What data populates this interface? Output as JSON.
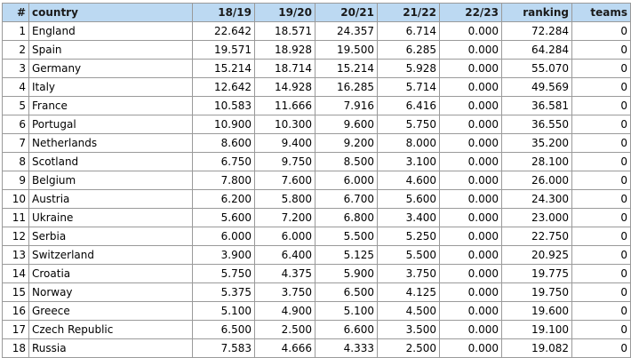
{
  "table": {
    "headers": [
      "#",
      "country",
      "18/19",
      "19/20",
      "20/21",
      "21/22",
      "22/23",
      "ranking",
      "teams"
    ],
    "rows": [
      [
        "1",
        "England",
        "22.642",
        "18.571",
        "24.357",
        "6.714",
        "0.000",
        "72.284",
        "0"
      ],
      [
        "2",
        "Spain",
        "19.571",
        "18.928",
        "19.500",
        "6.285",
        "0.000",
        "64.284",
        "0"
      ],
      [
        "3",
        "Germany",
        "15.214",
        "18.714",
        "15.214",
        "5.928",
        "0.000",
        "55.070",
        "0"
      ],
      [
        "4",
        "Italy",
        "12.642",
        "14.928",
        "16.285",
        "5.714",
        "0.000",
        "49.569",
        "0"
      ],
      [
        "5",
        "France",
        "10.583",
        "11.666",
        "7.916",
        "6.416",
        "0.000",
        "36.581",
        "0"
      ],
      [
        "6",
        "Portugal",
        "10.900",
        "10.300",
        "9.600",
        "5.750",
        "0.000",
        "36.550",
        "0"
      ],
      [
        "7",
        "Netherlands",
        "8.600",
        "9.400",
        "9.200",
        "8.000",
        "0.000",
        "35.200",
        "0"
      ],
      [
        "8",
        "Scotland",
        "6.750",
        "9.750",
        "8.500",
        "3.100",
        "0.000",
        "28.100",
        "0"
      ],
      [
        "9",
        "Belgium",
        "7.800",
        "7.600",
        "6.000",
        "4.600",
        "0.000",
        "26.000",
        "0"
      ],
      [
        "10",
        "Austria",
        "6.200",
        "5.800",
        "6.700",
        "5.600",
        "0.000",
        "24.300",
        "0"
      ],
      [
        "11",
        "Ukraine",
        "5.600",
        "7.200",
        "6.800",
        "3.400",
        "0.000",
        "23.000",
        "0"
      ],
      [
        "12",
        "Serbia",
        "6.000",
        "6.000",
        "5.500",
        "5.250",
        "0.000",
        "22.750",
        "0"
      ],
      [
        "13",
        "Switzerland",
        "3.900",
        "6.400",
        "5.125",
        "5.500",
        "0.000",
        "20.925",
        "0"
      ],
      [
        "14",
        "Croatia",
        "5.750",
        "4.375",
        "5.900",
        "3.750",
        "0.000",
        "19.775",
        "0"
      ],
      [
        "15",
        "Norway",
        "5.375",
        "3.750",
        "6.500",
        "4.125",
        "0.000",
        "19.750",
        "0"
      ],
      [
        "16",
        "Greece",
        "5.100",
        "4.900",
        "5.100",
        "4.500",
        "0.000",
        "19.600",
        "0"
      ],
      [
        "17",
        "Czech Republic",
        "6.500",
        "2.500",
        "6.600",
        "3.500",
        "0.000",
        "19.100",
        "0"
      ],
      [
        "18",
        "Russia",
        "7.583",
        "4.666",
        "4.333",
        "2.500",
        "0.000",
        "19.082",
        "0"
      ]
    ]
  },
  "colors": {
    "header_background": "#bcd9f2",
    "border": "#9a9a9a"
  }
}
